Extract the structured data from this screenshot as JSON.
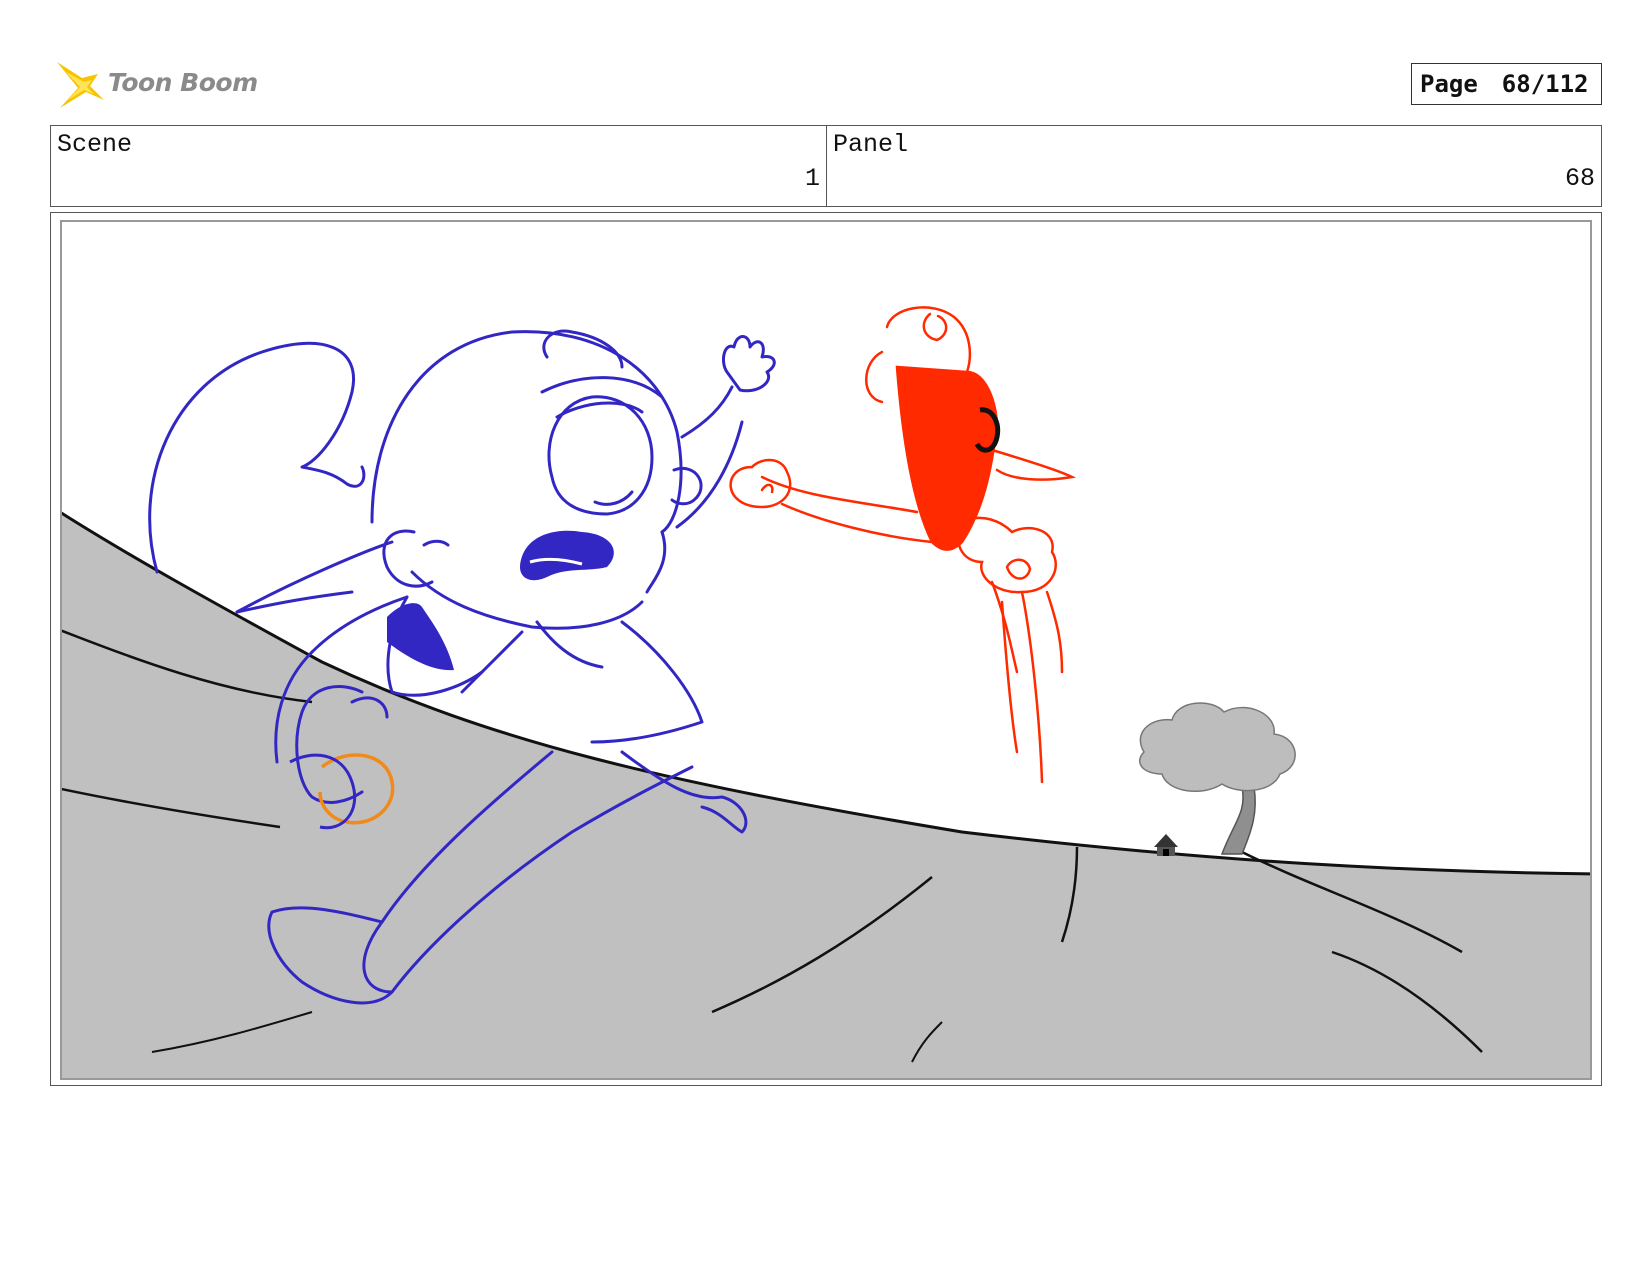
{
  "header": {
    "logo_text": "Toon Boom",
    "page_label": "Page",
    "page_number": "68/112"
  },
  "info": {
    "scene_label": "Scene",
    "scene_value": "1",
    "panel_label": "Panel",
    "panel_value": "68"
  },
  "colors": {
    "character_line": "#3327c4",
    "monster_line": "#ff2a00",
    "ground": "#c0c0c0",
    "ball_outline": "#f08a1c"
  }
}
